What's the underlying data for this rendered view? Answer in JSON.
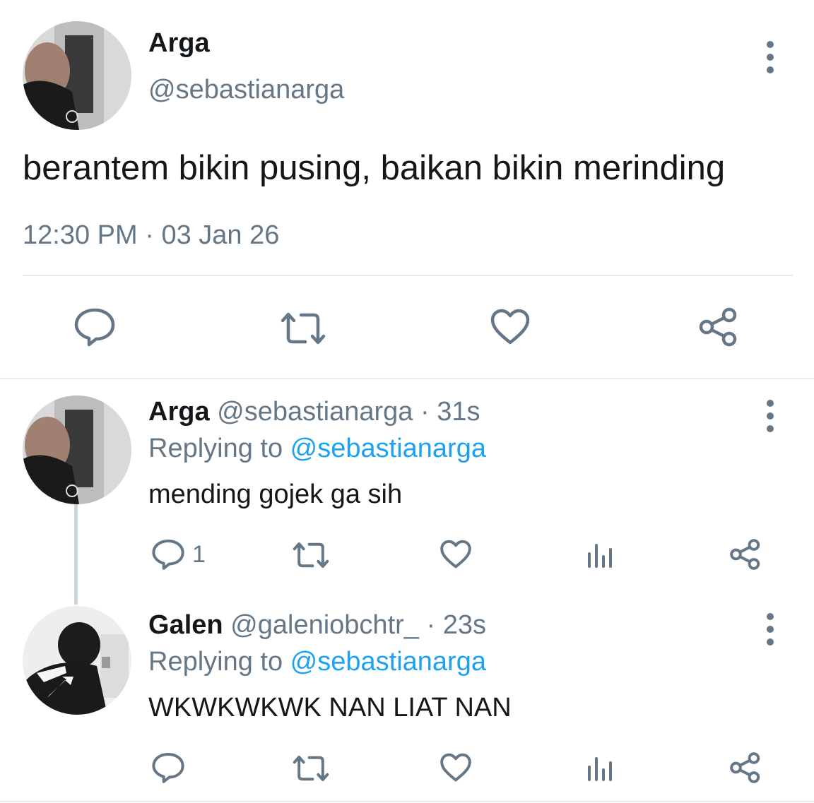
{
  "main_tweet": {
    "name": "Arga",
    "handle": "@sebastianarga",
    "text": "berantem bikin pusing, baikan bikin merinding",
    "time": "12:30 PM",
    "separator": " · ",
    "date": "03 Jan 26"
  },
  "replies": [
    {
      "name": "Arga",
      "handle": "@sebastianarga",
      "age": "31s",
      "replying_prefix": "Replying to ",
      "replying_to": "@sebastianarga",
      "text": "mending gojek ga sih",
      "reply_count": "1"
    },
    {
      "name": "Galen",
      "handle": "@galeniobchtr_",
      "age": "23s",
      "replying_prefix": "Replying to ",
      "replying_to": "@sebastianarga",
      "text": "WKWKWKWK NAN LIAT NAN",
      "reply_count": ""
    }
  ],
  "icons": [
    "reply-icon",
    "retweet-icon",
    "like-icon",
    "share-icon",
    "analytics-icon",
    "more-options-icon"
  ],
  "colors": {
    "text": "#14171a",
    "secondary": "#657786",
    "link": "#1da1f2",
    "divider": "#e6ecf0",
    "thread": "#ccd6dd"
  }
}
